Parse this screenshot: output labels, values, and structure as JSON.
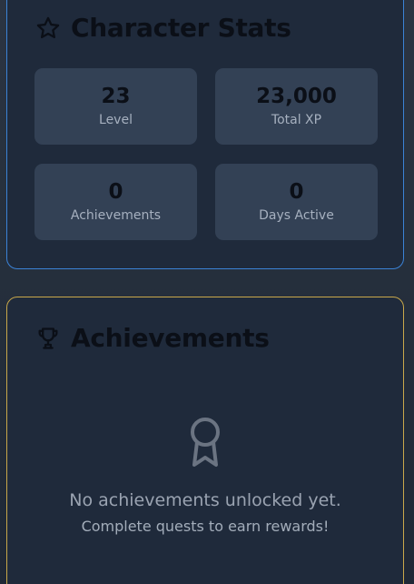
{
  "stats_panel": {
    "title": "Character Stats",
    "icon": "star-icon",
    "accent": "#3b82d6",
    "cards": [
      {
        "value": "23",
        "label": "Level"
      },
      {
        "value": "23,000",
        "label": "Total XP"
      },
      {
        "value": "0",
        "label": "Achievements"
      },
      {
        "value": "0",
        "label": "Days Active"
      }
    ]
  },
  "achievements_panel": {
    "title": "Achievements",
    "icon": "trophy-icon",
    "accent": "#c9a84a",
    "empty_icon": "award-ribbon-icon",
    "empty_message": "No achievements unlocked yet.",
    "empty_hint": "Complete quests to earn rewards!"
  }
}
